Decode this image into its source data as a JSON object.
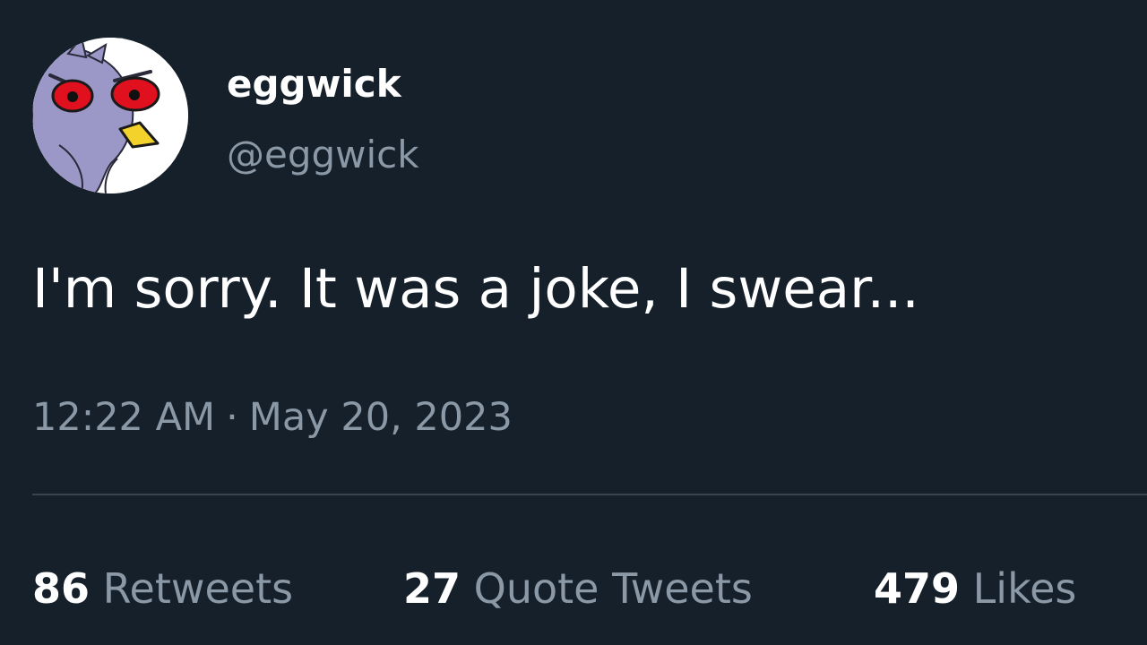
{
  "author": {
    "display_name": "eggwick",
    "handle": "@eggwick",
    "avatar_icon": "angry-bird-avatar-icon"
  },
  "tweet": {
    "text": "I'm sorry. It was a joke, I swear...",
    "time": "12:22 AM",
    "separator": "·",
    "date": "May 20, 2023"
  },
  "stats": {
    "retweets_count": "86",
    "retweets_label": "Retweets",
    "quotes_count": "27",
    "quotes_label": "Quote Tweets",
    "likes_count": "479",
    "likes_label": "Likes"
  },
  "colors": {
    "background": "#15202b",
    "primary_text": "#ffffff",
    "secondary_text": "#8b98a5",
    "divider": "#38444d"
  }
}
